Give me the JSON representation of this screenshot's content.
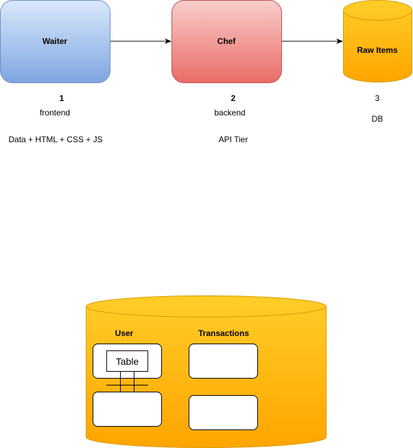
{
  "nodes": {
    "waiter": {
      "label": "Waiter",
      "fill_top": "#dae8fc",
      "fill_bottom": "#7ea6e0",
      "stroke": "#6c8ebf"
    },
    "chef": {
      "label": "Chef",
      "fill_top": "#f8cecc",
      "fill_bottom": "#ea6b66",
      "stroke": "#b85450"
    },
    "raw_items": {
      "label": "Raw Items",
      "fill_top": "#ffcd28",
      "fill_bottom": "#ffa500",
      "stroke": "#d79b00"
    }
  },
  "tiers": [
    {
      "number": "1",
      "name": "frontend",
      "detail": "Data + HTML + CSS + JS"
    },
    {
      "number": "2",
      "name": "backend",
      "detail": "API Tier"
    },
    {
      "number": "3",
      "name": "DB",
      "detail": ""
    }
  ],
  "database": {
    "fill_top": "#ffcd28",
    "fill_bottom": "#ffa500",
    "stroke": "#d79b00",
    "user_label": "User",
    "transactions_label": "Transactions",
    "table_label": "Table"
  },
  "colors": {
    "arrow": "#000000",
    "box_stroke": "#000000",
    "box_fill": "#ffffff"
  }
}
